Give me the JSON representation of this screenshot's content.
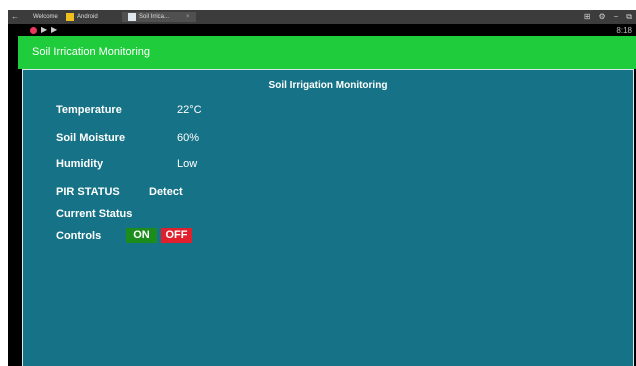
{
  "browser": {
    "tabs": [
      {
        "label": "Welcome"
      },
      {
        "label": "Android"
      },
      {
        "label": "Soil Irrica..."
      }
    ],
    "close_symbol": "×",
    "back_symbol": "←",
    "window_controls": {
      "network": "⊞",
      "settings": "⚙",
      "minimize": "−",
      "restore": "⧉"
    }
  },
  "status": {
    "play_symbol": "▶",
    "skip_symbol": "▶",
    "time": "8:18"
  },
  "app_bar": {
    "title": "Soil Irrication Monitoring"
  },
  "panel": {
    "title": "Soil Irrigation Monitoring",
    "readings": {
      "temperature_label": "Temperature",
      "temperature_value": "22°C",
      "moisture_label": "Soil Moisture",
      "moisture_value": "60%",
      "humidity_label": "Humidity",
      "humidity_value": "Low",
      "pir_label": "PIR STATUS",
      "pir_value": "Detect",
      "status_label": "Current Status"
    },
    "controls": {
      "label": "Controls",
      "on_label": "ON",
      "off_label": "OFF"
    }
  },
  "colors": {
    "app_bar": "#1fcc3c",
    "panel": "#167286",
    "on_button": "#1c8c1c",
    "off_button": "#e0202c"
  },
  "icons": [
    "back-arrow-icon",
    "welcome-tab-icon",
    "android-tab-icon",
    "app-tab-icon",
    "record-icon",
    "play-icon",
    "skip-icon",
    "network-icon",
    "settings-icon",
    "minimize-icon",
    "restore-icon"
  ]
}
